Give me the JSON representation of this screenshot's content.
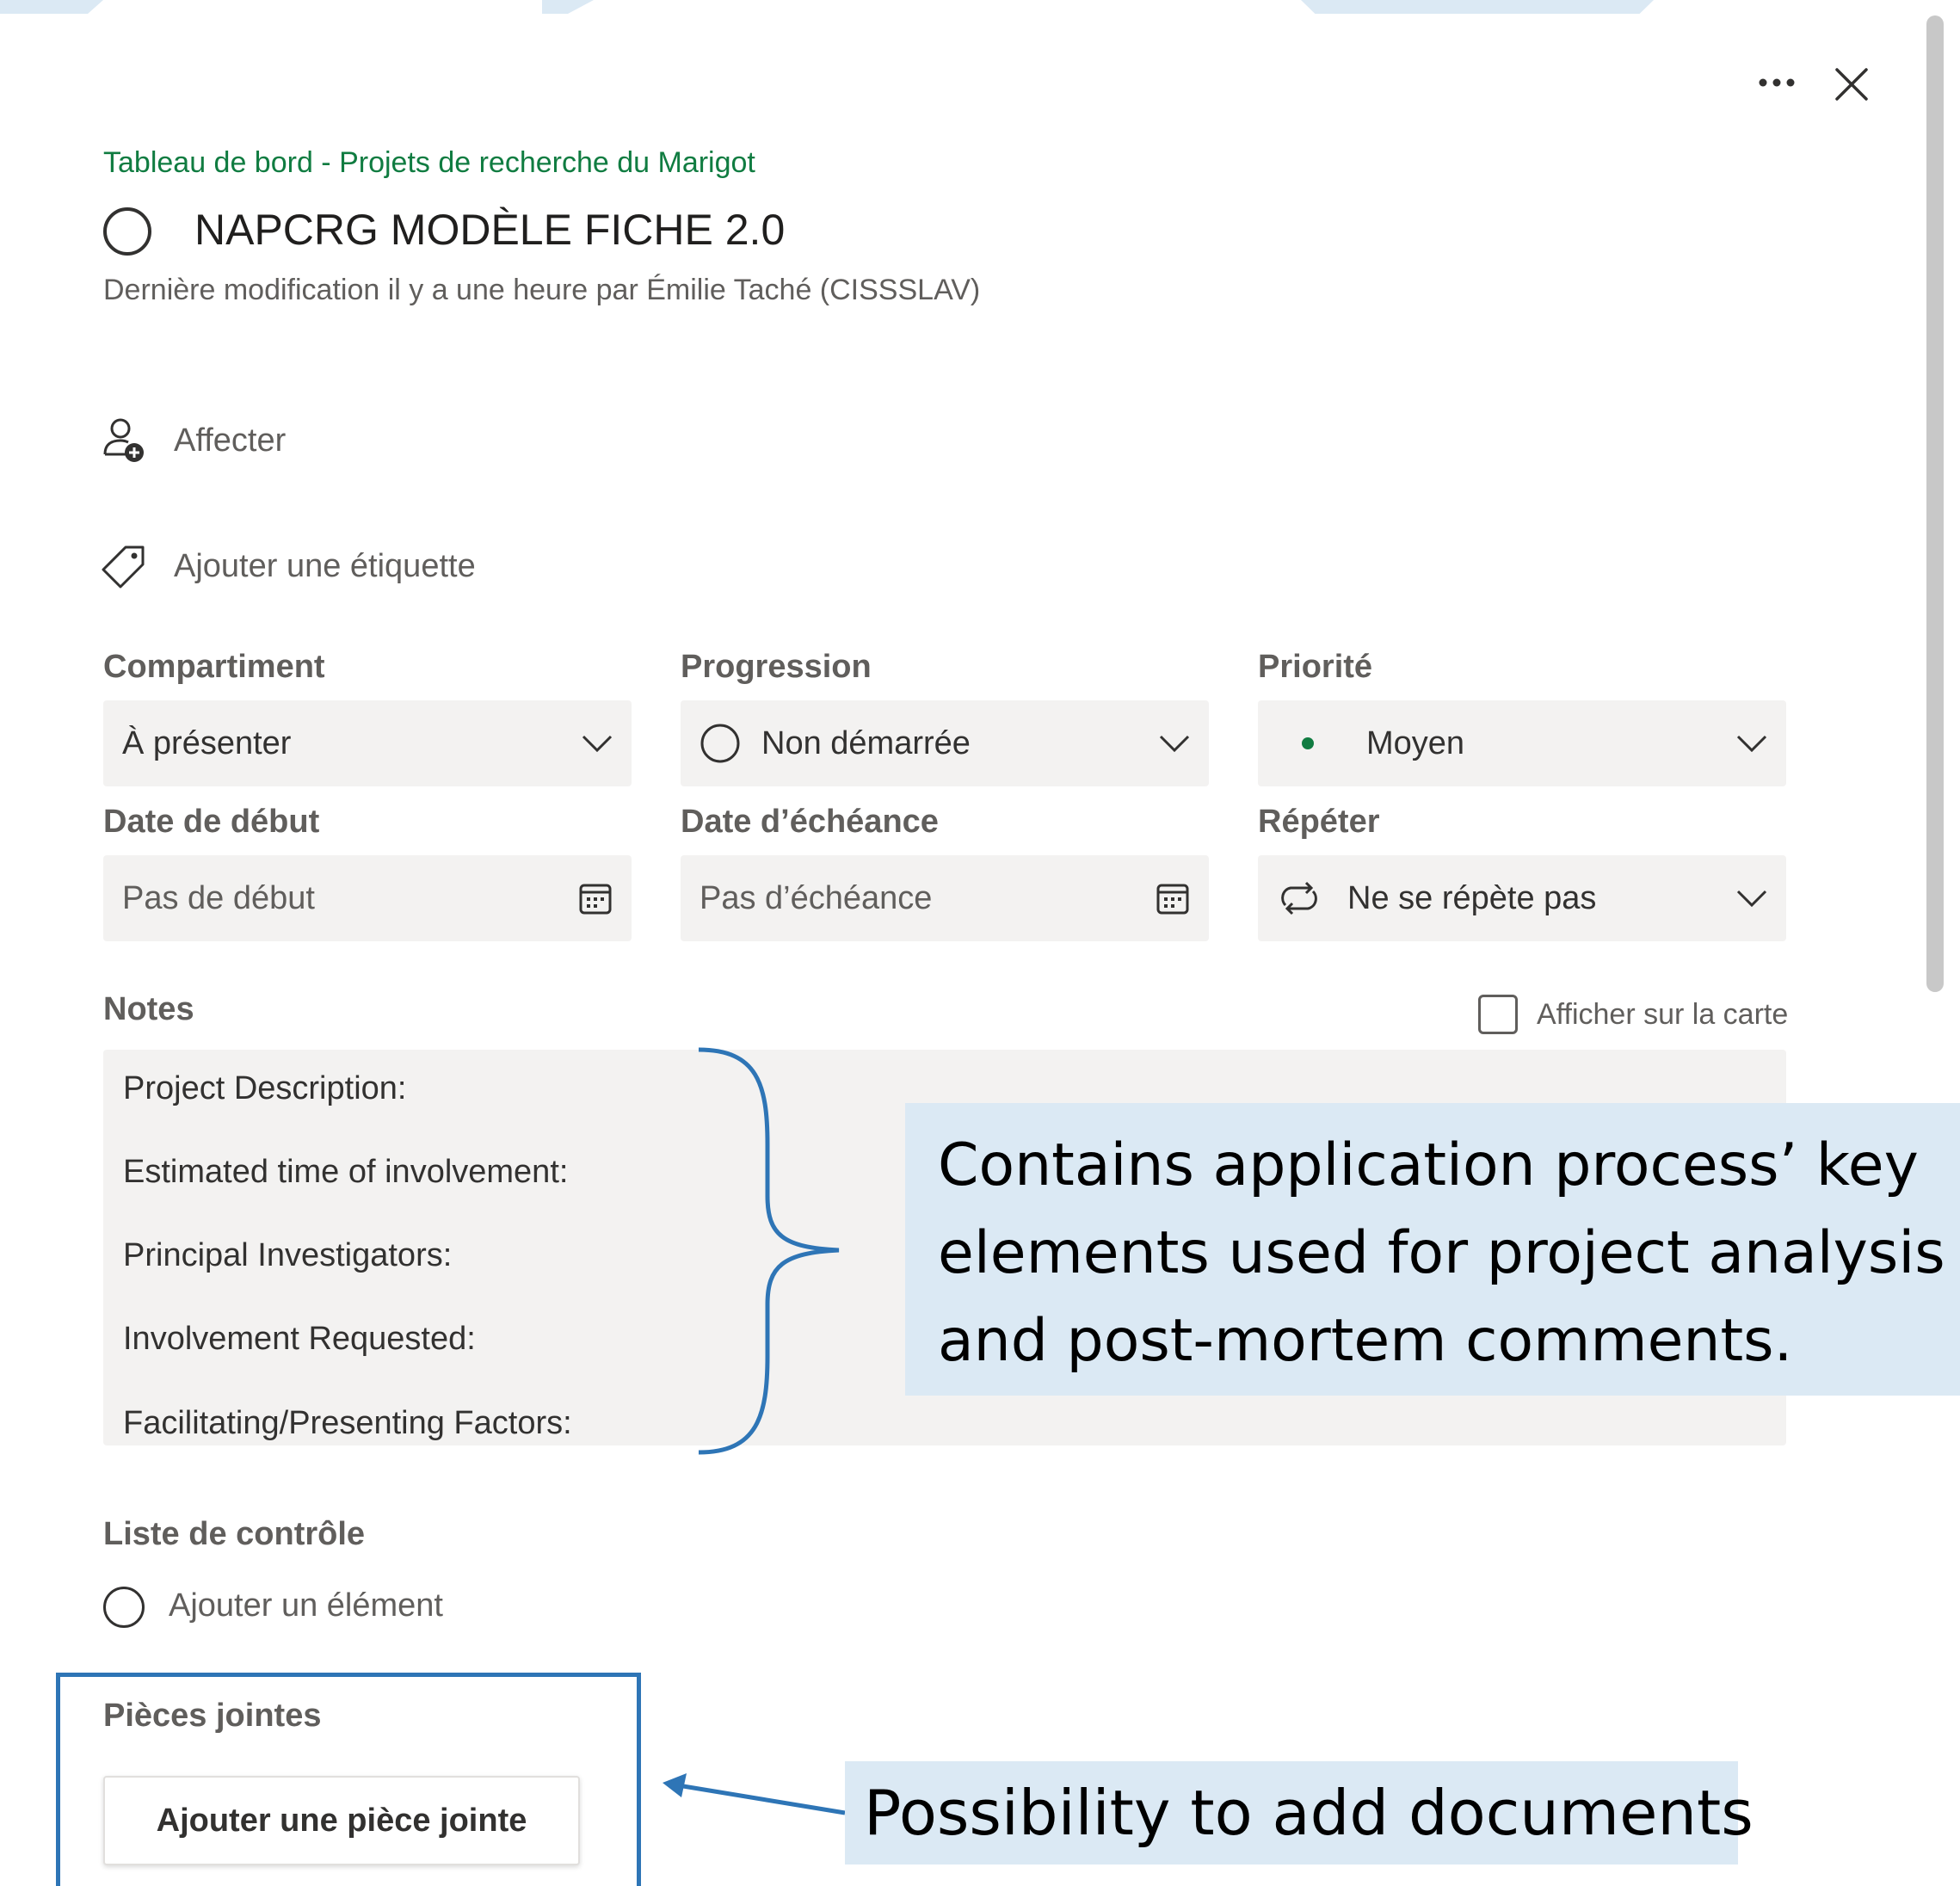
{
  "header": {
    "more_icon": "more-horizontal-icon",
    "close_icon": "close-icon"
  },
  "task": {
    "breadcrumb": "Tableau de bord - Projets de recherche du Marigot",
    "title": "NAPCRG MODÈLE FICHE 2.0",
    "last_modified": "Dernière modification il y a une heure par Émilie Taché (CISSSLAV)"
  },
  "actions": {
    "assign_label": "Affecter",
    "add_label_label": "Ajouter une étiquette"
  },
  "fields": {
    "bucket": {
      "label": "Compartiment",
      "value": "À présenter"
    },
    "progress": {
      "label": "Progression",
      "value": "Non démarrée"
    },
    "priority": {
      "label": "Priorité",
      "value": "Moyen"
    },
    "start_date": {
      "label": "Date de début",
      "placeholder": "Pas de début"
    },
    "due_date": {
      "label": "Date d’échéance",
      "placeholder": "Pas d’échéance"
    },
    "repeat": {
      "label": "Répéter",
      "value": "Ne se répète pas"
    }
  },
  "notes": {
    "label": "Notes",
    "show_on_card_label": "Afficher sur la carte",
    "show_on_card_checked": false,
    "lines": [
      "Project Description:",
      "Estimated time of involvement:",
      "Principal Investigators:",
      "Involvement Requested:",
      "Facilitating/Presenting Factors:"
    ]
  },
  "checklist": {
    "label": "Liste de contrôle",
    "add_item": "Ajouter un élément"
  },
  "attachments": {
    "label": "Pièces jointes",
    "add_button": "Ajouter une pièce jointe"
  },
  "annotations": {
    "notes_callout_lines": [
      "Contains application process’ key",
      "elements used for project analysis",
      "and post-mortem comments."
    ],
    "attachments_callout": "Possibility to add documents"
  },
  "colors": {
    "breadcrumb_green": "#107c41",
    "priority_dot_green": "#107c41",
    "annotation_blue": "#2e75b6",
    "callout_fill": "#dbe9f4",
    "field_fill": "#f3f2f1"
  }
}
